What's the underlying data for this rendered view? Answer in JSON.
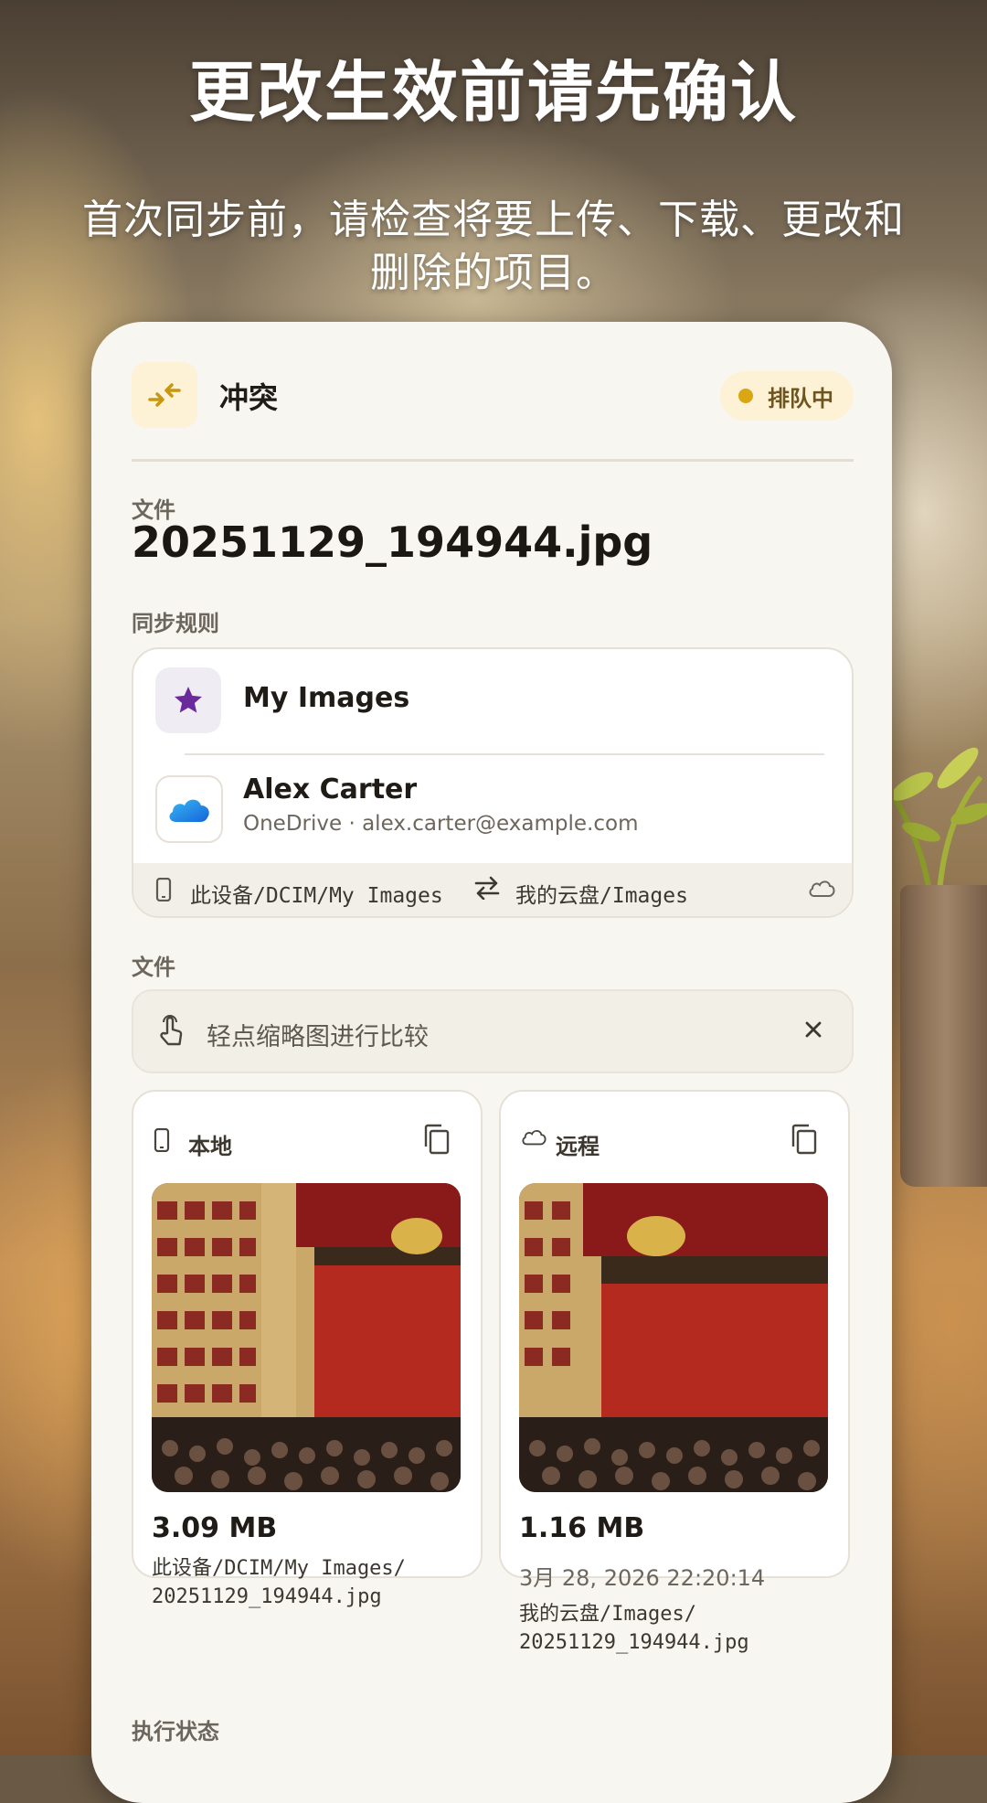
{
  "promo": {
    "headline": "更改生效前请先确认",
    "subtitle": "首次同步前，请检查将要上传、下载、更改和删除的项目。"
  },
  "item": {
    "type_label": "冲突",
    "type_icon": "conflict-arrows-icon",
    "status": "排队中",
    "status_color": "#d9a614",
    "file_label": "文件",
    "file_name": "20251129_194944.jpg"
  },
  "sync_rule": {
    "label": "同步规则",
    "name": "My Images",
    "name_icon": "star-icon",
    "star_color": "#6a2a9c",
    "account_name": "Alex Carter",
    "account_detail": "OneDrive · alex.carter@example.com",
    "local_path": "此设备/DCIM/My Images",
    "remote_path": "我的云盘/Images"
  },
  "files": {
    "label": "文件",
    "hint": "轻点缩略图进行比较",
    "local": {
      "label": "本地",
      "size": "3.09 MB",
      "path_line1": "此设备/DCIM/My Images/",
      "path_line2": "20251129_194944.jpg"
    },
    "remote": {
      "label": "远程",
      "size": "1.16 MB",
      "date": "3月 28, 2026 22:20:14",
      "path_line1": "我的云盘/Images/",
      "path_line2": "20251129_194944.jpg"
    }
  },
  "execution": {
    "label": "执行状态"
  },
  "colors": {
    "accent": "#d9a614",
    "card": "#f8f6f1"
  }
}
